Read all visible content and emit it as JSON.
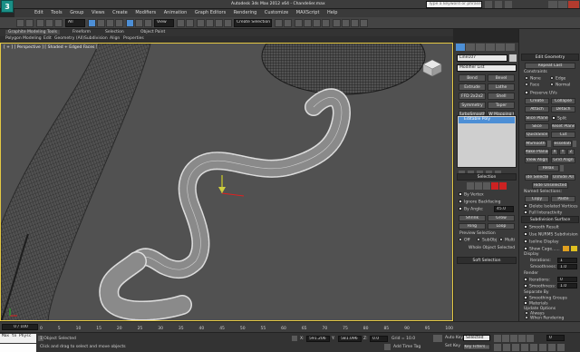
{
  "title": {
    "text": "Autodesk 3ds Max 2012 x64 - Chandelier.max",
    "search_placeholder": "Type a keyword or phrase"
  },
  "menu": [
    "Edit",
    "Tools",
    "Group",
    "Views",
    "Create",
    "Modifiers",
    "Animation",
    "Graph Editors",
    "Rendering",
    "Customize",
    "MAXScript",
    "Help"
  ],
  "toolbar": {
    "selection_set": "All",
    "view_dropdown": "View",
    "create_selection_set": "Create Selection Se"
  },
  "ribbon": {
    "tabs": [
      "Graphite Modeling Tools",
      "Freeform",
      "Selection",
      "Object Paint"
    ],
    "subtabs": [
      "Polygon Modeling",
      "Edit",
      "Geometry (All)",
      "Subdivision",
      "Align",
      "Properties"
    ]
  },
  "viewport": {
    "label": "[ + ] [ Perspective ] [ Shaded + Edged Faces ]"
  },
  "command_panel": {
    "object_name": "Line107",
    "modifier_list": "Modifier List",
    "modifier_buttons": [
      "Bend",
      "Bevel",
      "Extrude",
      "Lathe",
      "FFD 2x2x2",
      "Shell",
      "Symmetry",
      "Taper",
      "TurboSmooth",
      "UVW Mapping Cle"
    ],
    "stack_item": "Editable Poly",
    "selection": {
      "header": "Selection",
      "by_vertex": "By Vertex",
      "ignore_backfacing": "Ignore Backfacing",
      "by_angle": "By Angle:",
      "angle_value": "45.0",
      "shrink": "Shrink",
      "grow": "Grow",
      "ring": "Ring",
      "loop": "Loop",
      "preview_selection": "Preview Selection",
      "preview_off": "Off",
      "preview_subobj": "SubObj",
      "preview_multi": "Multi",
      "status": "Whole Object Selected"
    },
    "soft_selection": "Soft Selection"
  },
  "right_panel": {
    "edit_geometry": "Edit Geometry",
    "repeat_last": "Repeat Last",
    "constraints": "Constraints",
    "none": "None",
    "edge": "Edge",
    "face": "Face",
    "normal": "Normal",
    "preserve_uvs": "Preserve UVs",
    "create": "Create",
    "collapse": "Collapse",
    "attach": "Attach",
    "detach": "Detach",
    "slice_plane": "Slice Plane",
    "split": "Split",
    "slice": "Slice",
    "reset_plane": "Reset Plane",
    "quickslice": "QuickSlice",
    "cut": "Cut",
    "msmooth": "MSmooth",
    "tessellate": "Tessellate",
    "make_planar": "Make Planar",
    "x": "X",
    "y": "Y",
    "z": "Z",
    "view_align": "View Align",
    "grid_align": "Grid Align",
    "relax": "Relax",
    "hide_selected": "Hide Selected",
    "unhide_all": "Unhide All",
    "hide_unselected": "Hide Unselected",
    "named_selections": "Named Selections:",
    "copy": "Copy",
    "paste": "Paste",
    "delete_isolated": "Delete Isolated Vertices",
    "full_interactivity": "Full Interactivity",
    "subdivision_surface": "Subdivision Surface",
    "smooth_result": "Smooth Result",
    "use_nurms": "Use NURMS Subdivision",
    "isoline_display": "Isoline Display",
    "show_cage": "Show Cage......",
    "display": "Display",
    "iterations": "Iterations:",
    "iterations_value": "1",
    "smoothness": "Smoothness:",
    "smoothness_value": "1.0",
    "render": "Render",
    "render_iterations_value": "0",
    "render_smoothness_value": "1.0",
    "separate_by": "Separate By",
    "smoothing_groups": "Smoothing Groups",
    "materials": "Materials",
    "update_options": "Update Options",
    "always": "Always",
    "when_rendering": "When Rendering",
    "manually": "Manually"
  },
  "timeline": {
    "frame": "0 / 100",
    "ticks": [
      "0",
      "5",
      "10",
      "15",
      "20",
      "25",
      "30",
      "35",
      "40",
      "45",
      "50",
      "55",
      "60",
      "65",
      "70",
      "75",
      "80",
      "85",
      "90",
      "95",
      "100"
    ]
  },
  "status_bar": {
    "script_listener": "Max to Physc",
    "objects_selected": "1 Object Selected",
    "prompt": "Click and drag to select and move objects",
    "x_label": "X:",
    "x_value": "591.206",
    "y_label": "Y:",
    "y_value": "581.096",
    "z_label": "Z:",
    "z_value": "0.0",
    "grid": "Grid = 10.0",
    "add_time_tag": "Add Time Tag",
    "auto_key": "Auto Key",
    "selected": "Selected",
    "set_key": "Set Key",
    "key_filters": "Key Filters...",
    "frame_value": "0"
  },
  "colors": {
    "accent_yellow": "#e4c843",
    "selected_blue": "#4d8fd6",
    "logo_teal": "#1a8f86"
  }
}
